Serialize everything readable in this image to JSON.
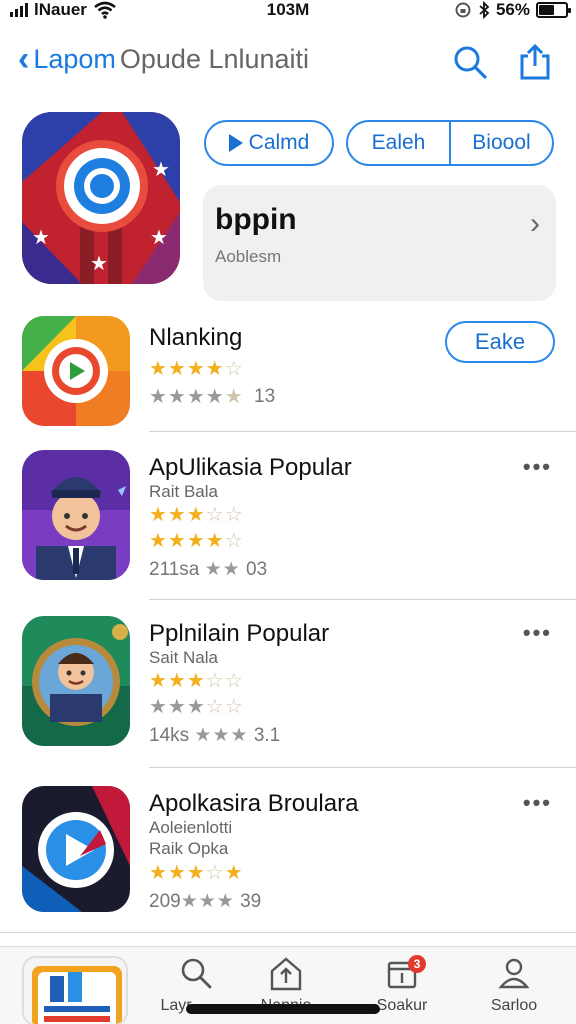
{
  "status": {
    "carrier": "lNauer",
    "time": "103M",
    "battery": "56%",
    "battery_level": 0.56
  },
  "nav": {
    "back_title": "Lapom",
    "title_rest": "Opude Lnlunaiti",
    "icons": [
      "search-icon",
      "share-icon"
    ]
  },
  "featured": {
    "get_label": "Calmd",
    "split_left": "Ealeh",
    "split_right": "Bioool",
    "name": "bppin",
    "subtitle": "Aoblesm"
  },
  "apps": [
    {
      "title": "Nlanking",
      "subtitle": "",
      "button": "Eake",
      "rating1": 3.5,
      "rating2": 4,
      "meta": "13"
    },
    {
      "title": "ApUlikasia Popular",
      "subtitle": "Rait Bala",
      "rating1": 3,
      "rating2": 4,
      "meta_prefix": "211sa",
      "meta": "03"
    },
    {
      "title": "Pplnilain Popular",
      "subtitle": "Sait Nala",
      "rating1": 3,
      "rating2": 3,
      "meta_prefix": "14ks",
      "meta": "3.1"
    },
    {
      "title": "Apolkasira Broulara",
      "subtitle": "Aoleienlotti",
      "subtitle2": "Raik Opka",
      "rating1": 3,
      "meta_prefix": "209",
      "meta": "39"
    }
  ],
  "tabs": [
    {
      "label": "",
      "icon": "app-thumbnail"
    },
    {
      "label": "Layr",
      "icon": "search-icon"
    },
    {
      "label": "Nannio",
      "icon": "arrow-up-icon"
    },
    {
      "label": "Soakur",
      "icon": "calendar-icon",
      "badge": "3"
    },
    {
      "label": "Sarloo",
      "icon": "person-icon"
    }
  ]
}
